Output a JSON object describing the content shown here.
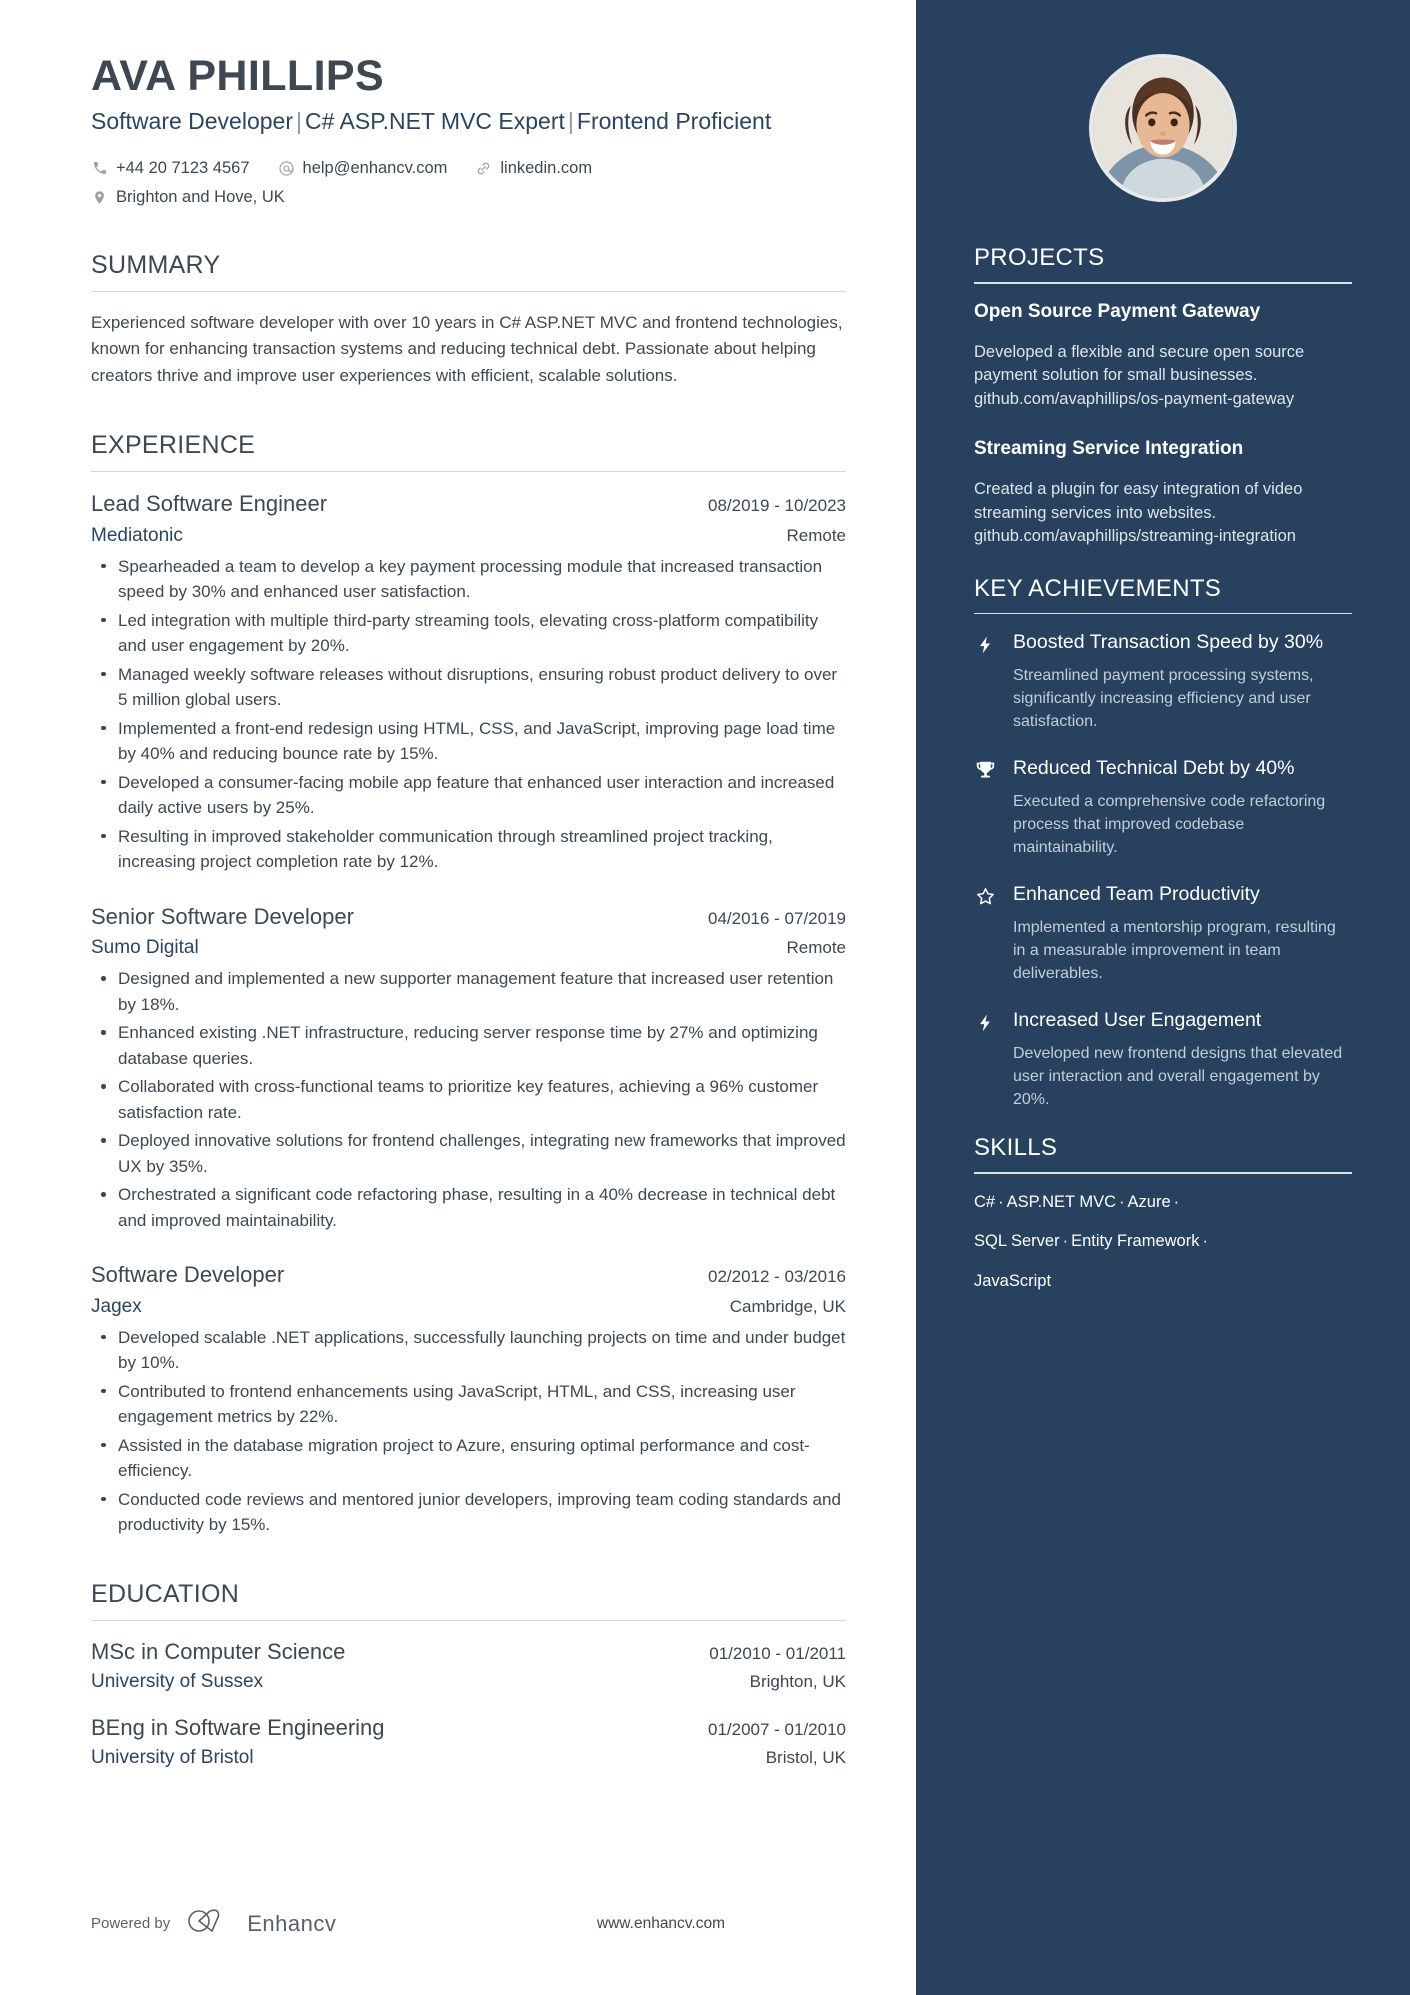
{
  "colors": {
    "sidebar_bg": "#27415e",
    "heading": "#3d4852",
    "accent": "#2c4460",
    "rule": "#d3d7db"
  },
  "header": {
    "name": "AVA PHILLIPS",
    "headline_parts": [
      "Software Developer",
      "C# ASP.NET MVC Expert",
      "Frontend Proficient"
    ],
    "headline_separator": "|",
    "contacts_row1": [
      {
        "icon": "phone-icon",
        "text": "+44 20 7123 4567"
      },
      {
        "icon": "email-icon",
        "text": "help@enhancv.com"
      },
      {
        "icon": "link-icon",
        "text": "linkedin.com"
      }
    ],
    "contacts_row2": [
      {
        "icon": "location-pin-icon",
        "text": "Brighton and Hove, UK"
      }
    ]
  },
  "summary": {
    "title": "SUMMARY",
    "text": "Experienced software developer with over 10 years in C# ASP.NET MVC and frontend technologies, known for enhancing transaction systems and reducing technical debt. Passionate about helping creators thrive and improve user experiences with efficient, scalable solutions."
  },
  "experience": {
    "title": "EXPERIENCE",
    "jobs": [
      {
        "title": "Lead Software Engineer",
        "date": "08/2019 - 10/2023",
        "company": "Mediatonic",
        "location": "Remote",
        "bullets": [
          "Spearheaded a team to develop a key payment processing module that increased transaction speed by 30% and enhanced user satisfaction.",
          "Led integration with multiple third-party streaming tools, elevating cross-platform compatibility and user engagement by 20%.",
          "Managed weekly software releases without disruptions, ensuring robust product delivery to over 5 million global users.",
          "Implemented a front-end redesign using HTML, CSS, and JavaScript, improving page load time by 40% and reducing bounce rate by 15%.",
          "Developed a consumer-facing mobile app feature that enhanced user interaction and increased daily active users by 25%.",
          "Resulting in improved stakeholder communication through streamlined project tracking, increasing project completion rate by 12%."
        ]
      },
      {
        "title": "Senior Software Developer",
        "date": "04/2016 - 07/2019",
        "company": "Sumo Digital",
        "location": "Remote",
        "bullets": [
          "Designed and implemented a new supporter management feature that increased user retention by 18%.",
          "Enhanced existing .NET infrastructure, reducing server response time by 27% and optimizing database queries.",
          "Collaborated with cross-functional teams to prioritize key features, achieving a 96% customer satisfaction rate.",
          "Deployed innovative solutions for frontend challenges, integrating new frameworks that improved UX by 35%.",
          "Orchestrated a significant code refactoring phase, resulting in a 40% decrease in technical debt and improved maintainability."
        ]
      },
      {
        "title": "Software Developer",
        "date": "02/2012 - 03/2016",
        "company": "Jagex",
        "location": "Cambridge, UK",
        "bullets": [
          "Developed scalable .NET applications, successfully launching projects on time and under budget by 10%.",
          "Contributed to frontend enhancements using JavaScript, HTML, and CSS, increasing user engagement metrics by 22%.",
          "Assisted in the database migration project to Azure, ensuring optimal performance and cost-efficiency.",
          "Conducted code reviews and mentored junior developers, improving team coding standards and productivity by 15%."
        ]
      }
    ]
  },
  "education": {
    "title": "EDUCATION",
    "entries": [
      {
        "degree": "MSc in Computer Science",
        "date": "01/2010 - 01/2011",
        "school": "University of Sussex",
        "location": "Brighton, UK"
      },
      {
        "degree": "BEng in Software Engineering",
        "date": "01/2007 - 01/2010",
        "school": "University of Bristol",
        "location": "Bristol, UK"
      }
    ]
  },
  "footer": {
    "powered_by": "Powered by",
    "brand": "Enhancv",
    "url": "www.enhancv.com"
  },
  "sidebar": {
    "projects": {
      "title": "PROJECTS",
      "items": [
        {
          "name": "Open Source Payment Gateway",
          "description": "Developed a flexible and secure open source payment solution for small businesses. github.com/avaphillips/os-payment-gateway"
        },
        {
          "name": "Streaming Service Integration",
          "description": "Created a plugin for easy integration of video streaming services into websites. github.com/avaphillips/streaming-integration"
        }
      ]
    },
    "achievements": {
      "title": "KEY ACHIEVEMENTS",
      "items": [
        {
          "icon": "lightning-bolt-icon",
          "title": "Boosted Transaction Speed by 30%",
          "description": "Streamlined payment processing systems, significantly increasing efficiency and user satisfaction."
        },
        {
          "icon": "trophy-icon",
          "title": "Reduced Technical Debt by 40%",
          "description": "Executed a comprehensive code refactoring process that improved codebase maintainability."
        },
        {
          "icon": "star-icon",
          "title": "Enhanced Team Productivity",
          "description": "Implemented a mentorship program, resulting in a measurable improvement in team deliverables."
        },
        {
          "icon": "lightning-bolt-icon",
          "title": "Increased User Engagement",
          "description": "Developed new frontend designs that elevated user interaction and overall engagement by 20%."
        }
      ]
    },
    "skills": {
      "title": "SKILLS",
      "separator": "·",
      "lines": [
        [
          "C#",
          "ASP.NET MVC",
          "Azure",
          ""
        ],
        [
          "SQL Server",
          "Entity Framework",
          ""
        ],
        [
          "JavaScript"
        ]
      ]
    }
  }
}
